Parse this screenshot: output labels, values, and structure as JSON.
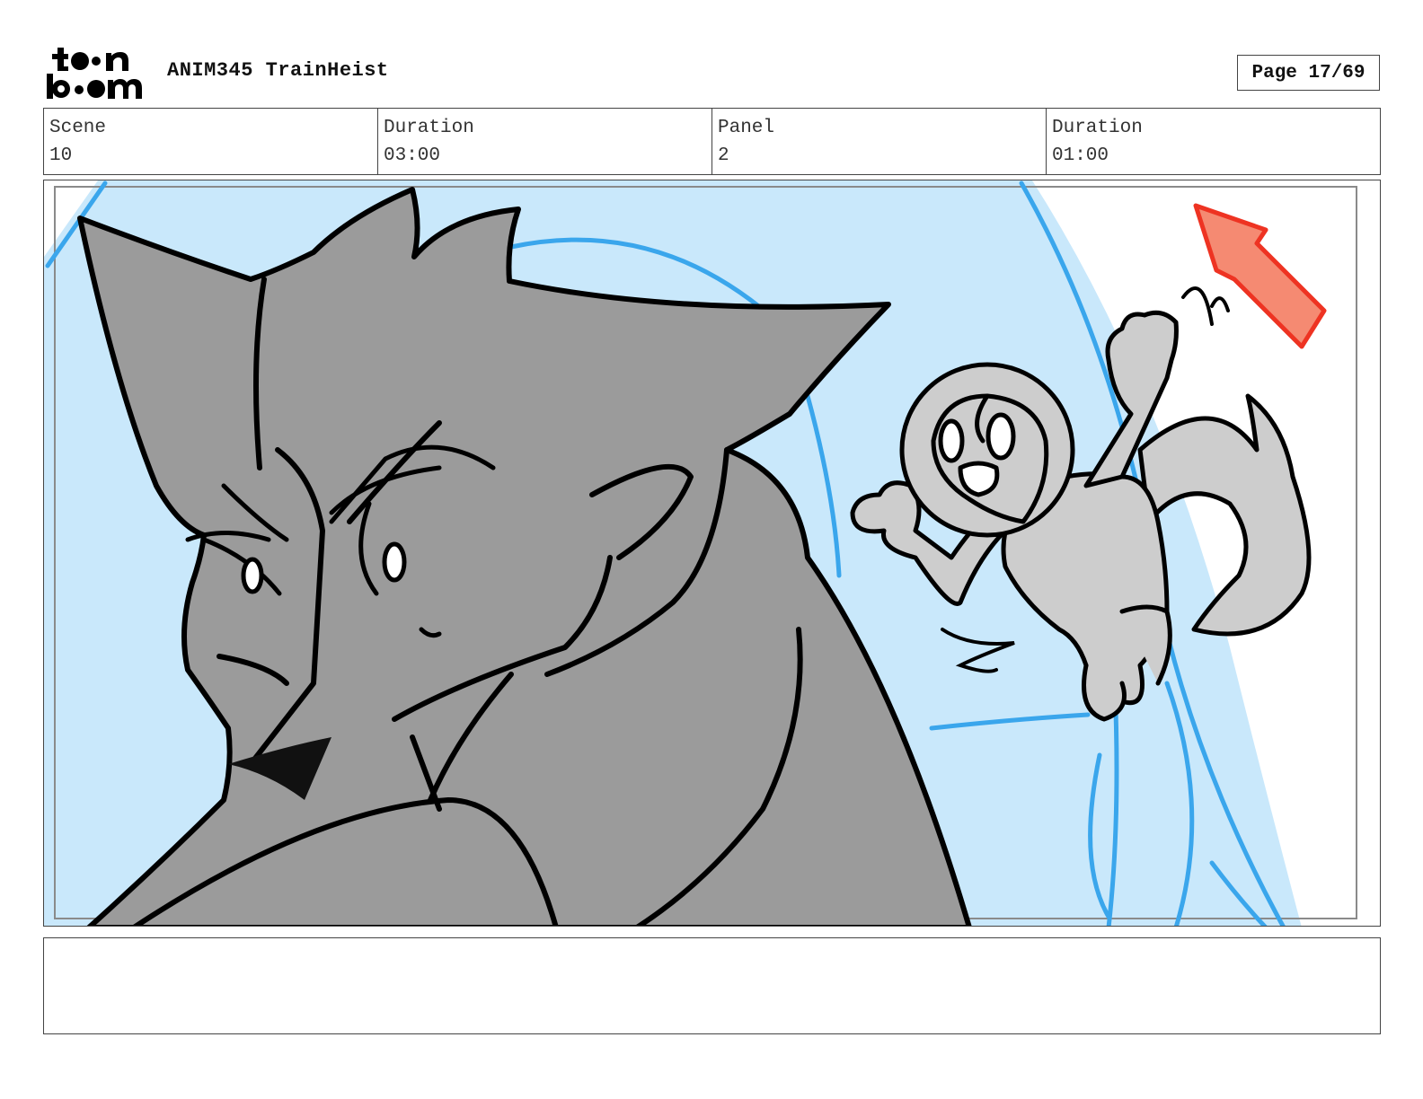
{
  "header": {
    "logo_text": "toonboom",
    "project_title": "ANIM345 TrainHeist",
    "page_label": "Page 17/69"
  },
  "panel_info": {
    "scene_label": "Scene",
    "scene_value": "10",
    "scene_duration_label": "Duration",
    "scene_duration_value": "03:00",
    "panel_label": "Panel",
    "panel_value": "2",
    "panel_duration_label": "Duration",
    "panel_duration_value": "01:00"
  },
  "notes": {
    "text": ""
  },
  "colors": {
    "sky": "#c9e8fb",
    "sky_lines": "#3aa6ec",
    "wolf_fill": "#9b9b9b",
    "astronaut_fill": "#cdcdcd",
    "arrow": "#f58a72",
    "arrow_stroke": "#ee3322"
  },
  "icons": {
    "logo": "toonboom-logo",
    "arrow": "direction-arrow-up-left"
  }
}
